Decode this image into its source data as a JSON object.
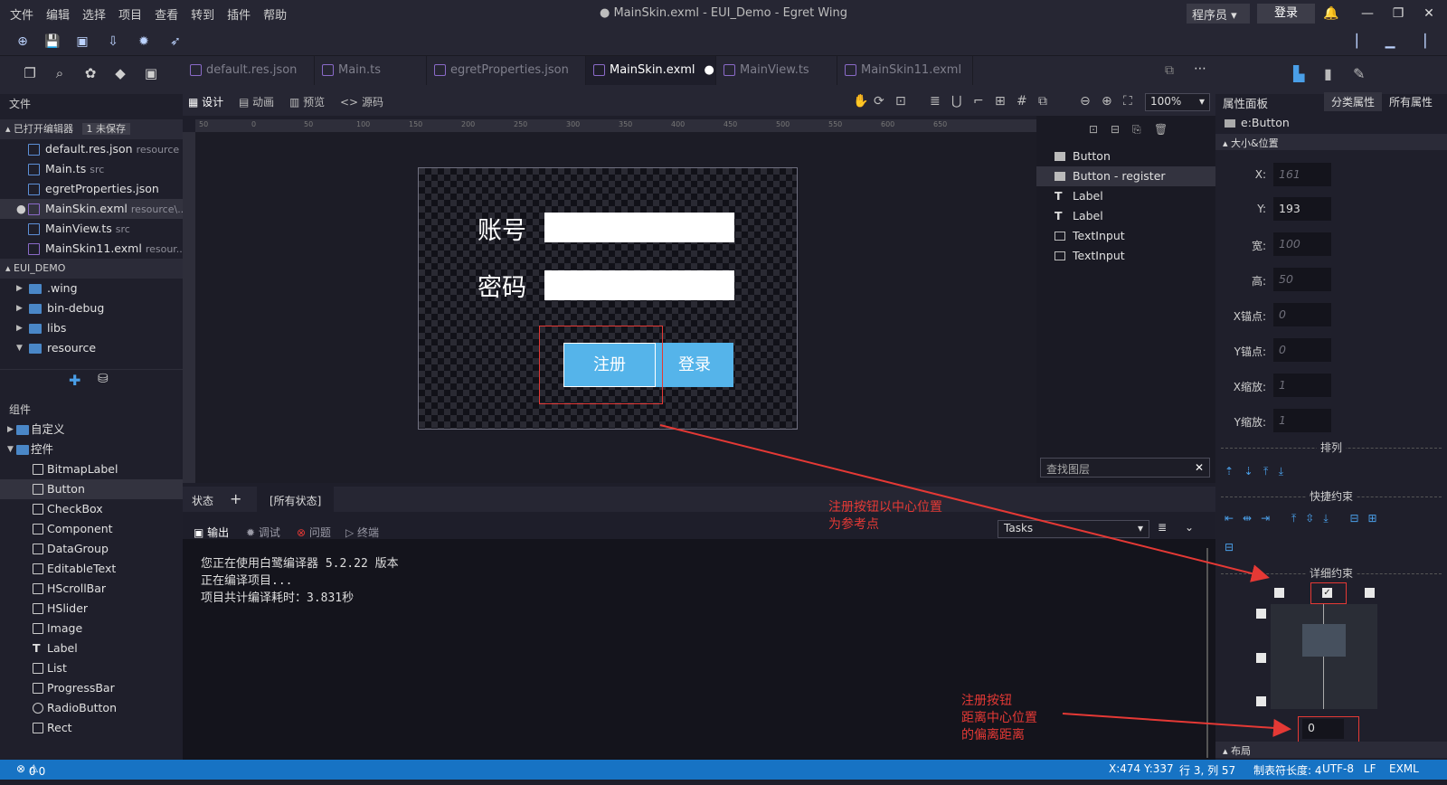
{
  "menu": [
    "文件",
    "编辑",
    "选择",
    "项目",
    "查看",
    "转到",
    "插件",
    "帮助"
  ],
  "window_title": "● MainSkin.exml - EUI_Demo - Egret Wing",
  "role": "程序员",
  "login": "登录",
  "tabs": [
    {
      "label": "default.res.json"
    },
    {
      "label": "Main.ts"
    },
    {
      "label": "egretProperties.json"
    },
    {
      "label": "MainSkin.exml"
    },
    {
      "label": "MainView.ts"
    },
    {
      "label": "MainSkin11.exml"
    }
  ],
  "left": {
    "files_header": "文件",
    "open_editors": "已打开编辑器",
    "unsaved_badge": "1 未保存",
    "open_files": [
      {
        "name": "default.res.json",
        "dir": "resource"
      },
      {
        "name": "Main.ts",
        "dir": "src"
      },
      {
        "name": "egretProperties.json",
        "dir": ""
      },
      {
        "name": "MainSkin.exml",
        "dir": "resource\\..."
      },
      {
        "name": "MainView.ts",
        "dir": "src"
      },
      {
        "name": "MainSkin11.exml",
        "dir": "resour..."
      }
    ],
    "project": "EUI_DEMO",
    "tree": [
      ".wing",
      "bin-debug",
      "libs",
      "resource"
    ],
    "components_header": "组件",
    "custom": "自定义",
    "controls": "控件",
    "components": [
      "BitmapLabel",
      "Button",
      "CheckBox",
      "Component",
      "DataGroup",
      "EditableText",
      "HScrollBar",
      "HSlider",
      "Image",
      "Label",
      "List",
      "ProgressBar",
      "RadioButton",
      "Rect"
    ]
  },
  "design": {
    "modes": [
      "设计",
      "动画",
      "预览",
      "源码"
    ],
    "zoom": "100%",
    "ruler_ticks": [
      "50",
      "0",
      "50",
      "100",
      "150",
      "200",
      "250",
      "300",
      "350",
      "400",
      "450",
      "500",
      "550",
      "600",
      "650"
    ]
  },
  "stage": {
    "account_label": "账号",
    "password_label": "密码",
    "register_btn": "注册",
    "login_btn": "登录"
  },
  "layers": {
    "items": [
      "Button",
      "Button - register",
      "Label",
      "Label",
      "TextInput",
      "TextInput"
    ],
    "search_placeholder": "查找图层"
  },
  "states": {
    "label": "状态",
    "all": "[所有状态]"
  },
  "output": {
    "tabs": [
      "输出",
      "调试",
      "问题",
      "终端"
    ],
    "tasks": "Tasks",
    "lines": [
      "您正在使用白鹭编译器 5.2.22 版本",
      "正在编译项目...",
      "项目共计编译耗时：3.831秒"
    ]
  },
  "props": {
    "title": "属性面板",
    "tab_category": "分类属性",
    "tab_all": "所有属性",
    "target": "e:Button",
    "section_size": "大小&位置",
    "fields": [
      {
        "label": "X:",
        "value": "161",
        "dim": true
      },
      {
        "label": "Y:",
        "value": "193",
        "dim": false
      },
      {
        "label": "宽:",
        "value": "100",
        "dim": true
      },
      {
        "label": "高:",
        "value": "50",
        "dim": true
      },
      {
        "label": "X锚点:",
        "value": "0",
        "dim": true
      },
      {
        "label": "Y锚点:",
        "value": "0",
        "dim": true
      },
      {
        "label": "X缩放:",
        "value": "1",
        "dim": true
      },
      {
        "label": "Y缩放:",
        "value": "1",
        "dim": true
      }
    ],
    "arrange": "排列",
    "quick_constraint": "快捷约束",
    "detail_constraint": "详细约束",
    "offset_value": "0",
    "layout": "布局"
  },
  "annotations": {
    "a1_line1": "注册按钮以中心位置",
    "a1_line2": "为参考点",
    "a2_line1": "注册按钮",
    "a2_line2": "距离中心位置",
    "a2_line3": "的偏离距离"
  },
  "status": {
    "errors": "0",
    "warnings": "0",
    "cursor": "X:474 Y:337",
    "position": "行 3, 列 57",
    "tab_size": "制表符长度: 4",
    "encoding": "UTF-8",
    "eol": "LF",
    "lang": "EXML"
  },
  "colors": {
    "accent": "#1773c4",
    "button": "#55b4ea",
    "annotation": "#e53935"
  }
}
